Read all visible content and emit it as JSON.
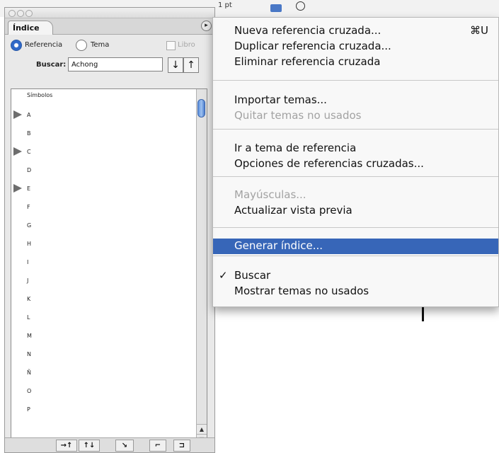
{
  "top_bar": {
    "size_label": "1 pt"
  },
  "palette": {
    "tab_label": "Índice",
    "menu_button_icon": "palette-menu-icon",
    "radio_referencia": "Referencia",
    "radio_tema": "Tema",
    "checkbox_libro": "Libro",
    "search_label": "Buscar:",
    "search_value": "Achong",
    "arrow_down_icon": "↓",
    "arrow_up_icon": "↑",
    "list": [
      {
        "label": "Símbolos",
        "expandable": false
      },
      {
        "label": "A",
        "expandable": true
      },
      {
        "label": "B",
        "expandable": false
      },
      {
        "label": "C",
        "expandable": true
      },
      {
        "label": "D",
        "expandable": false
      },
      {
        "label": "E",
        "expandable": true
      },
      {
        "label": "F",
        "expandable": false
      },
      {
        "label": "G",
        "expandable": false
      },
      {
        "label": "H",
        "expandable": false
      },
      {
        "label": "I",
        "expandable": false
      },
      {
        "label": "J",
        "expandable": false
      },
      {
        "label": "K",
        "expandable": false
      },
      {
        "label": "L",
        "expandable": false
      },
      {
        "label": "M",
        "expandable": false
      },
      {
        "label": "N",
        "expandable": false
      },
      {
        "label": "Ñ",
        "expandable": false
      },
      {
        "label": "O",
        "expandable": false
      },
      {
        "label": "P",
        "expandable": false
      }
    ],
    "bottom_icons": [
      "go-to-selected-icon",
      "update-preview-icon",
      "new-entry-icon",
      "delete-icon",
      "generate-icon"
    ]
  },
  "menu": {
    "items": [
      {
        "label": "Nueva referencia cruzada...",
        "shortcut": "⌘U",
        "disabled": false
      },
      {
        "label": "Duplicar referencia cruzada...",
        "disabled": false
      },
      {
        "label": "Eliminar referencia cruzada",
        "disabled": false
      },
      {
        "label": "Importar temas...",
        "disabled": false
      },
      {
        "label": "Quitar temas no usados",
        "disabled": true
      },
      {
        "label": "Ir a tema de referencia",
        "disabled": false
      },
      {
        "label": "Opciones de referencias cruzadas...",
        "disabled": false
      },
      {
        "label": "Mayúsculas...",
        "disabled": true
      },
      {
        "label": "Actualizar vista previa",
        "disabled": false
      },
      {
        "label": "Generar índice...",
        "disabled": false,
        "selected": true
      },
      {
        "label": "Buscar",
        "disabled": false,
        "checked": true
      },
      {
        "label": "Mostrar temas no usados",
        "disabled": false
      }
    ],
    "checkmark": "✓"
  },
  "colors": {
    "menu_highlight": "#3766b8",
    "radio_accent": "#2f68c8",
    "scroll_thumb": "#5a8fdc"
  }
}
